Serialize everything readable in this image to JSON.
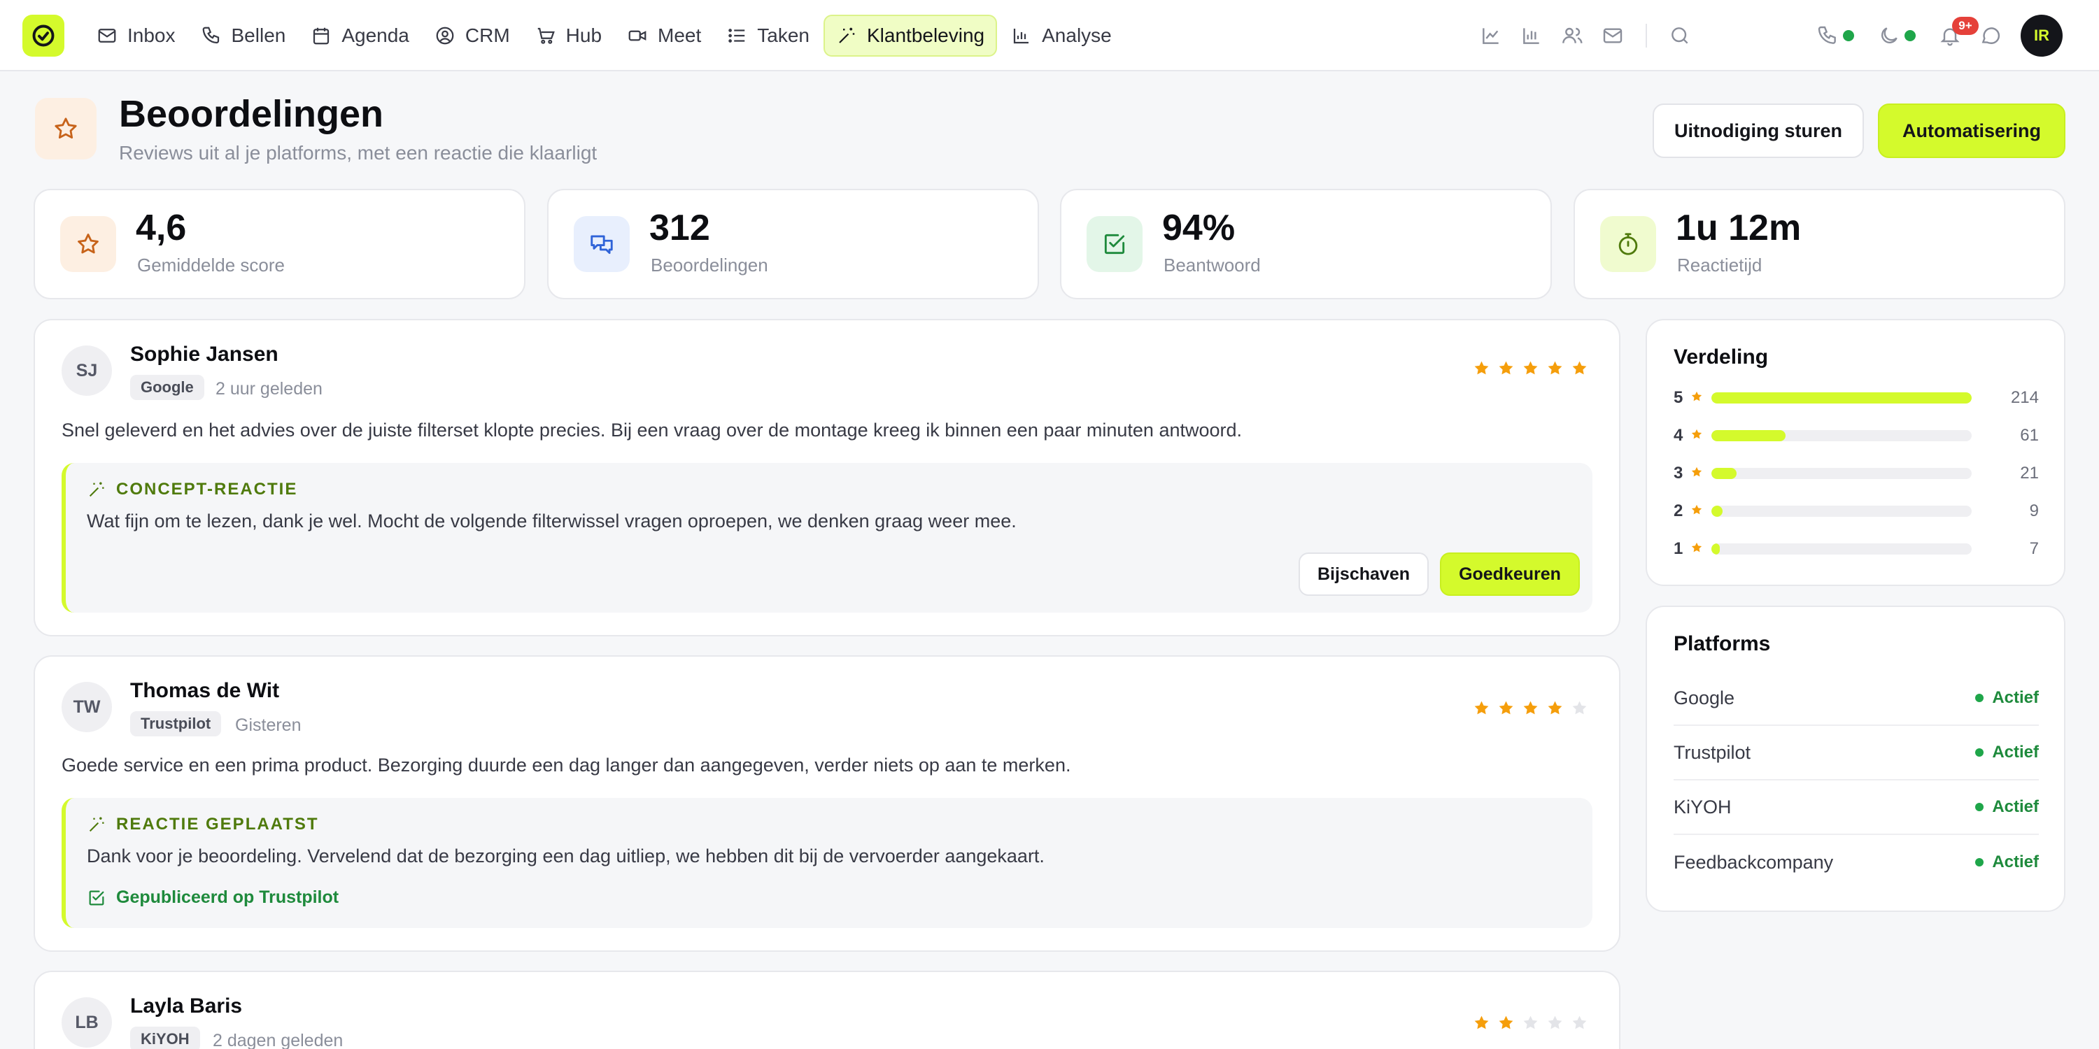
{
  "nav": {
    "items": [
      {
        "label": "Inbox",
        "icon": "mail-icon"
      },
      {
        "label": "Bellen",
        "icon": "phone-icon"
      },
      {
        "label": "Agenda",
        "icon": "calendar-icon"
      },
      {
        "label": "CRM",
        "icon": "user-circle-icon"
      },
      {
        "label": "Hub",
        "icon": "cart-icon"
      },
      {
        "label": "Meet",
        "icon": "video-icon"
      },
      {
        "label": "Taken",
        "icon": "list-icon"
      },
      {
        "label": "Klantbeleving",
        "icon": "sparkle-icon",
        "active": true
      },
      {
        "label": "Analyse",
        "icon": "bar-chart-icon"
      }
    ],
    "notifications_badge": "9+",
    "user_initials": "IR"
  },
  "header": {
    "title": "Beoordelingen",
    "subtitle": "Reviews uit al je platforms, met een reactie die klaarligt",
    "invite_button": "Uitnodiging sturen",
    "automation_button": "Automatisering"
  },
  "stats": [
    {
      "value": "4,6",
      "label": "Gemiddelde score",
      "icon": "star-icon"
    },
    {
      "value": "312",
      "label": "Beoordelingen",
      "icon": "chat-bubbles-icon"
    },
    {
      "value": "94%",
      "label": "Beantwoord",
      "icon": "check-square-icon"
    },
    {
      "value": "1u 12m",
      "label": "Reactietijd",
      "icon": "stopwatch-icon"
    }
  ],
  "reviews": [
    {
      "initials": "SJ",
      "name": "Sophie Jansen",
      "platform": "Google",
      "time": "2 uur geleden",
      "rating": 5,
      "text": "Snel geleverd en het advies over de juiste filterset klopte precies. Bij een vraag over de montage kreeg ik binnen een paar minuten antwoord.",
      "reply_label": "CONCEPT-REACTIE",
      "reply_text": "Wat fijn om te lezen, dank je wel. Mocht de volgende filterwissel vragen oproepen, we denken graag weer mee.",
      "refine_button": "Bijschaven",
      "approve_button": "Goedkeuren"
    },
    {
      "initials": "TW",
      "name": "Thomas de Wit",
      "platform": "Trustpilot",
      "time": "Gisteren",
      "rating": 4,
      "text": "Goede service en een prima product. Bezorging duurde een dag langer dan aangegeven, verder niets op aan te merken.",
      "reply_label": "REACTIE GEPLAATST",
      "reply_text": "Dank voor je beoordeling. Vervelend dat de bezorging een dag uitliep, we hebben dit bij de vervoerder aangekaart.",
      "published": "Gepubliceerd op Trustpilot"
    },
    {
      "initials": "LB",
      "name": "Layla Baris",
      "platform": "KiYOH",
      "time": "2 dagen geleden",
      "rating": 2
    }
  ],
  "distribution": {
    "title": "Verdeling",
    "rows": [
      {
        "stars": "5",
        "count": "214",
        "fraction": 1.0
      },
      {
        "stars": "4",
        "count": "61",
        "fraction": 0.285
      },
      {
        "stars": "3",
        "count": "21",
        "fraction": 0.098
      },
      {
        "stars": "2",
        "count": "9",
        "fraction": 0.042
      },
      {
        "stars": "1",
        "count": "7",
        "fraction": 0.033
      }
    ]
  },
  "platforms": {
    "title": "Platforms",
    "items": [
      {
        "name": "Google",
        "status": "Actief"
      },
      {
        "name": "Trustpilot",
        "status": "Actief"
      },
      {
        "name": "KiYOH",
        "status": "Actief"
      },
      {
        "name": "Feedbackcompany",
        "status": "Actief"
      }
    ]
  },
  "colors": {
    "accent": "#d4fa2c",
    "star": "#f59e0b",
    "star_empty": "#e3e4e8",
    "success": "#1e8a3c"
  }
}
